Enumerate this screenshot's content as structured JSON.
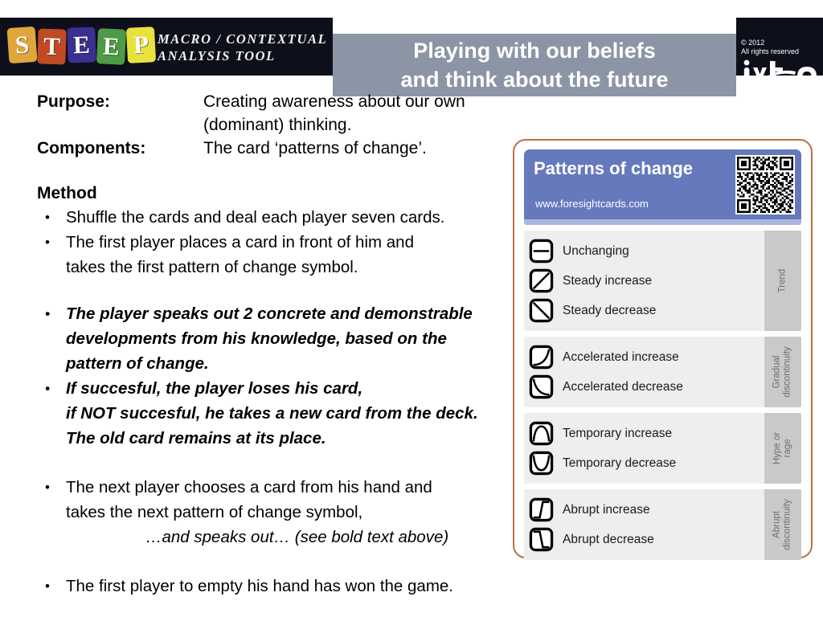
{
  "header": {
    "logo_letters": [
      "S",
      "T",
      "E",
      "E",
      "P"
    ],
    "logo_subtitle": "MACRO / CONTEXTUAL\nANALYSIS TOOL",
    "banner_title": "Playing with our beliefs\nand think about the future",
    "copyright": "© 2012\nAll rights reserved",
    "brand_logo": "ivto",
    "banner_color": "#8b95a6",
    "logo_tile_colors": [
      "#e0a53c",
      "#bf4a24",
      "#3b2f8f",
      "#4f9a46",
      "#e8e23c"
    ]
  },
  "meta": {
    "purpose_label": "Purpose:",
    "purpose_value": "Creating awareness about our own (dominant) thinking.",
    "components_label": "Components:",
    "components_value": "The card ‘patterns of change’."
  },
  "method": {
    "heading": "Method",
    "items": [
      "Shuffle the cards and deal each player seven cards.",
      "The first player places a card in front of him and\ntakes the first pattern of change symbol.",
      "The player speaks out 2 concrete and demonstrable\ndevelopments from his knowledge, based on the\npattern of change.",
      "If succesful, the player loses his card,\nif NOT succesful, he takes a new card from the deck.\nThe old card remains at its place.",
      "The next player chooses a card from his hand and\ntakes the next pattern of change symbol,",
      "The first player to empty his hand has won the game."
    ],
    "speaks_out_line": "…and speaks out… (see bold text above)"
  },
  "card": {
    "title": "Patterns of change",
    "url": "www.foresightcards.com",
    "header_color": "#6679bd",
    "border_color": "#bc7142",
    "groups": [
      {
        "tab_label": "Trend",
        "patterns": [
          {
            "label": "Unchanging",
            "icon": "unchanging-icon"
          },
          {
            "label": "Steady increase",
            "icon": "steady-increase-icon"
          },
          {
            "label": "Steady decrease",
            "icon": "steady-decrease-icon"
          }
        ]
      },
      {
        "tab_label": "Gradual\ndiscontinuity",
        "patterns": [
          {
            "label": "Accelerated increase",
            "icon": "accelerated-increase-icon"
          },
          {
            "label": "Accelerated decrease",
            "icon": "accelerated-decrease-icon"
          }
        ]
      },
      {
        "tab_label": "Hype or rage",
        "patterns": [
          {
            "label": "Temporary increase",
            "icon": "temporary-increase-icon"
          },
          {
            "label": "Temporary decrease",
            "icon": "temporary-decrease-icon"
          }
        ]
      },
      {
        "tab_label": "Abrupt\ndiscontinuity",
        "patterns": [
          {
            "label": "Abrupt increase",
            "icon": "abrupt-increase-icon"
          },
          {
            "label": "Abrupt decrease",
            "icon": "abrupt-decrease-icon"
          }
        ]
      }
    ]
  }
}
